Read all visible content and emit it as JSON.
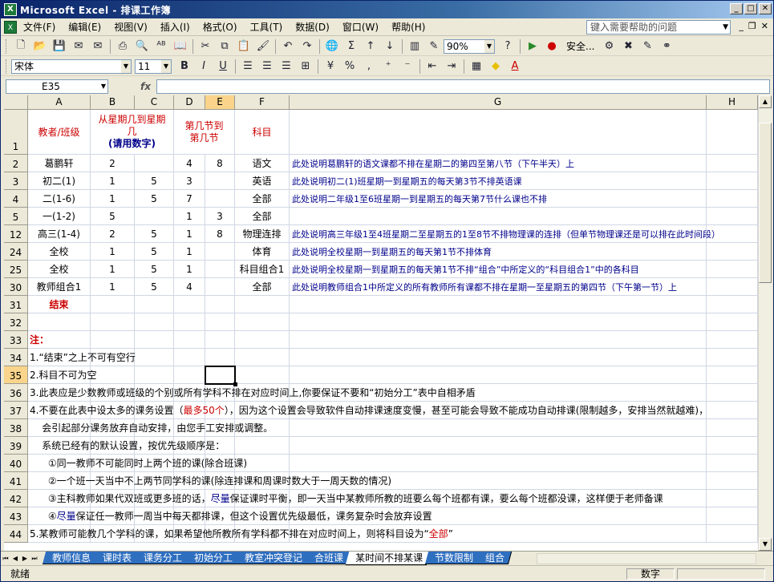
{
  "window": {
    "title": "Microsoft Excel - 排课工作簿"
  },
  "menu": {
    "items": [
      "文件(F)",
      "编辑(E)",
      "视图(V)",
      "插入(I)",
      "格式(O)",
      "工具(T)",
      "数据(D)",
      "窗口(W)",
      "帮助(H)"
    ],
    "help_placeholder": "键入需要帮助的问题"
  },
  "toolbar": {
    "zoom": "90%",
    "security_label": "安全..."
  },
  "format_toolbar": {
    "font": "宋体",
    "size": "11"
  },
  "namebox": {
    "value": "E35"
  },
  "columns": [
    "A",
    "B",
    "C",
    "D",
    "E",
    "F",
    "G",
    "H"
  ],
  "header_row": {
    "row": "1",
    "a": "教者/班级",
    "bc_line1": "从星期几到星期",
    "bc_line2": "几",
    "bc_line3": "(请用数字)",
    "de_line1": "第几节到",
    "de_line2": "第几节",
    "f": "科目"
  },
  "rows": [
    {
      "row": "2",
      "a": "葛鹏轩",
      "b": "2",
      "c": "",
      "d": "4",
      "e": "8",
      "f": "语文",
      "g": "此处说明葛鹏轩的语文课都不排在星期二的第四至第八节（下午半天）上"
    },
    {
      "row": "3",
      "a": "初二(1)",
      "b": "1",
      "c": "5",
      "d": "3",
      "e": "",
      "f": "英语",
      "g": "此处说明初二(1)班星期一到星期五的每天第3节不排英语课"
    },
    {
      "row": "4",
      "a": "二(1-6)",
      "b": "1",
      "c": "5",
      "d": "7",
      "e": "",
      "f": "全部",
      "g": "此处说明二年级1至6班星期一到星期五的每天第7节什么课也不排"
    },
    {
      "row": "5",
      "a": "一(1-2)",
      "b": "5",
      "c": "",
      "d": "1",
      "e": "3",
      "f": "全部",
      "g": ""
    },
    {
      "row": "12",
      "a": "高三(1-4)",
      "b": "2",
      "c": "5",
      "d": "1",
      "e": "8",
      "f": "物理连排",
      "g": "此处说明高三年级1至4班星期二至星期五的1至8节不排物理课的连排（但单节物理课还是可以排在此时间段）"
    },
    {
      "row": "24",
      "a": "全校",
      "b": "1",
      "c": "5",
      "d": "1",
      "e": "",
      "f": "体育",
      "g": "此处说明全校星期一到星期五的每天第1节不排体育"
    },
    {
      "row": "25",
      "a": "全校",
      "b": "1",
      "c": "5",
      "d": "1",
      "e": "",
      "f": "科目组合1",
      "g": "此处说明全校星期一到星期五的每天第1节不排“组合”中所定义的“科目组合1”中的各科目"
    },
    {
      "row": "30",
      "a": "教师组合1",
      "b": "1",
      "c": "5",
      "d": "4",
      "e": "",
      "f": "全部",
      "g": "此处说明教师组合1中所定义的所有教师所有课都不排在星期一至星期五的第四节（下午第一节）上"
    },
    {
      "row": "31",
      "a": "结束",
      "b": "",
      "c": "",
      "d": "",
      "e": "",
      "f": "",
      "g": ""
    },
    {
      "row": "32",
      "a": "",
      "b": "",
      "c": "",
      "d": "",
      "e": "",
      "f": "",
      "g": ""
    }
  ],
  "notes": [
    {
      "row": "33",
      "text": "注："
    },
    {
      "row": "34",
      "text": "1.“结束”之上不可有空行"
    },
    {
      "row": "35",
      "text": "2.科目不可为空"
    },
    {
      "row": "36",
      "text": "3.此表应是少数教师或班级的个别或所有学科不排在对应时间上,你要保证不要和“初始分工”表中自相矛盾"
    },
    {
      "row": "37",
      "text_a": "4.不要在此表中设太多的课务设置（",
      "text_b": "最多50个",
      "text_c": "），因为这个设置会导致软件自动排课速度变慢，甚至可能会导致不能成功自动排课(限制越多，安排当然就越难)，"
    },
    {
      "row": "38",
      "text": "    会引起部分课务放弃自动安排，由您手工安排或调整。"
    },
    {
      "row": "39",
      "text": "    系统已经有的默认设置，按优先级顺序是："
    },
    {
      "row": "40",
      "text": "      ①同一教师不可能同时上两个班的课(除合班课)"
    },
    {
      "row": "41",
      "text": "      ②一个班一天当中不上两节同学科的课(除连排课和周课时数大于一周天数的情况)"
    },
    {
      "row": "42",
      "text_a": "      ③主科教师如果代双班或更多班的话，",
      "text_b": "尽量",
      "text_c": "保证课时平衡，即一天当中某教师所教的班要么每个班都有课，要么每个班都没课，这样便于老师备课"
    },
    {
      "row": "43",
      "text_a": "      ④",
      "text_b": "尽量",
      "text_c": "保证任一教师一周当中每天都排课，但这个设置优先级最低，课务复杂时会放弃设置"
    },
    {
      "row": "44",
      "text_a": "5.某教师可能教几个学科的课，如果希望他所教所有学科都不排在对应时间上，则将科目设为“",
      "text_b": "全部",
      "text_c": "”"
    }
  ],
  "sheet_tabs": [
    "教师信息",
    "课时表",
    "课务分工",
    "初始分工",
    "教室冲突登记",
    "合班课",
    "某时间不排某课",
    "节数限制",
    "组合"
  ],
  "active_tab": "某时间不排某课",
  "status": {
    "left": "就绪",
    "right": "数字"
  },
  "colors": {
    "header_red": "#cc0000",
    "note_blue": "#00008b",
    "tab_blue": "#2f6fc0",
    "selected_header": "#f9d48a"
  }
}
